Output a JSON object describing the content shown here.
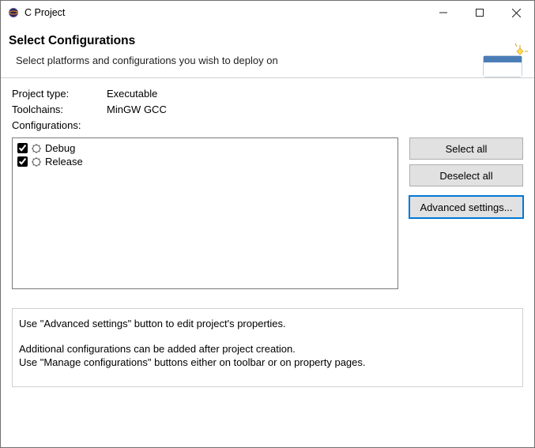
{
  "window": {
    "title": "C Project"
  },
  "header": {
    "title": "Select Configurations",
    "subtitle": "Select platforms and configurations you wish to deploy on"
  },
  "info": {
    "project_type_label": "Project type:",
    "project_type_value": "Executable",
    "toolchains_label": "Toolchains:",
    "toolchains_value": "MinGW GCC",
    "configurations_label": "Configurations:"
  },
  "configs": [
    {
      "name": "Debug",
      "checked": true
    },
    {
      "name": "Release",
      "checked": true
    }
  ],
  "buttons": {
    "select_all": "Select all",
    "deselect_all": "Deselect all",
    "advanced": "Advanced settings..."
  },
  "hints": {
    "line1": "Use \"Advanced settings\" button to edit project's properties.",
    "line2": "Additional configurations can be added after project creation.",
    "line3": "Use \"Manage configurations\" buttons either on toolbar or on property pages."
  }
}
